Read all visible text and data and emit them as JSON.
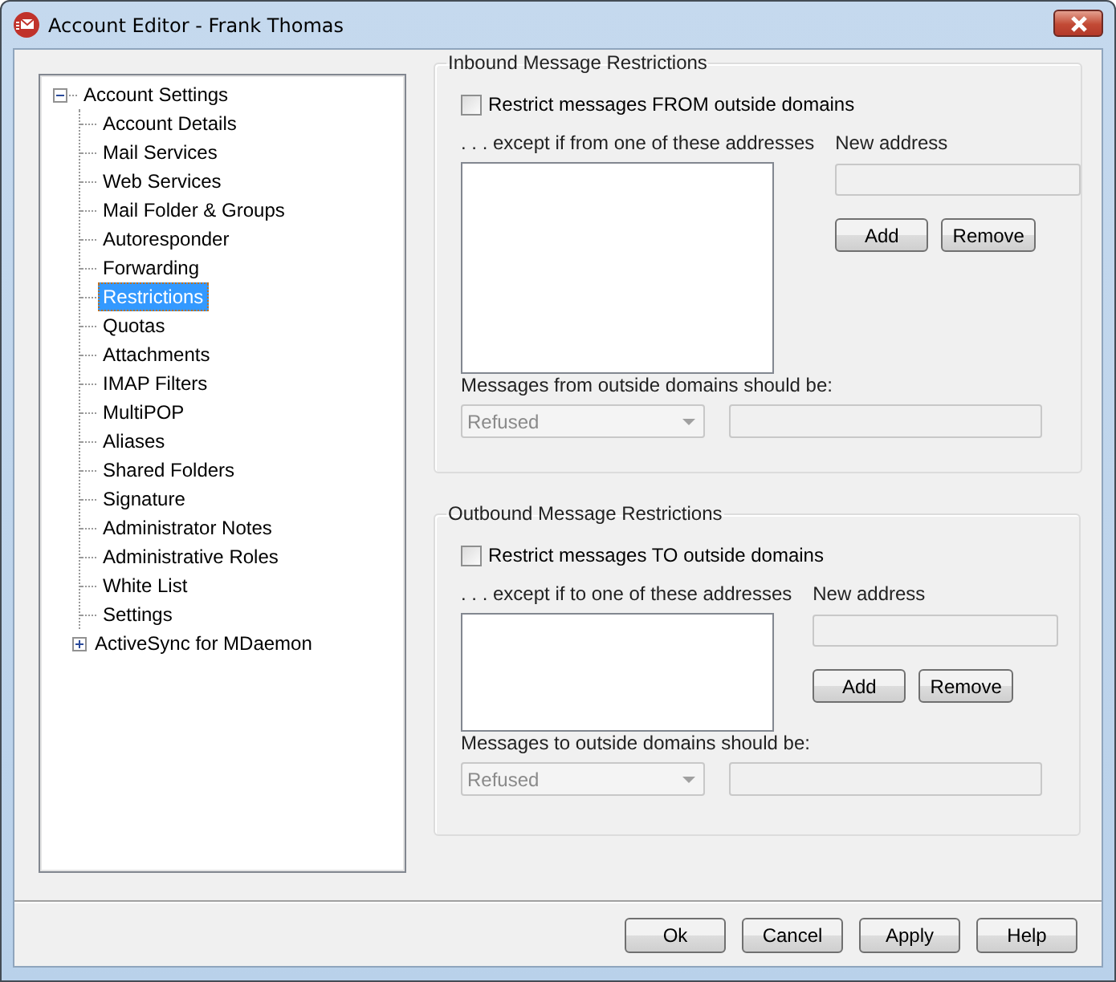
{
  "window": {
    "title": "Account Editor - Frank Thomas"
  },
  "tree": {
    "label": "Account Settings",
    "expanded": true,
    "selected": false,
    "children": [
      {
        "label": "Account Details",
        "selected": false
      },
      {
        "label": "Mail Services",
        "selected": false
      },
      {
        "label": "Web Services",
        "selected": false
      },
      {
        "label": "Mail Folder & Groups",
        "selected": false
      },
      {
        "label": "Autoresponder",
        "selected": false
      },
      {
        "label": "Forwarding",
        "selected": false
      },
      {
        "label": "Restrictions",
        "selected": true
      },
      {
        "label": "Quotas",
        "selected": false
      },
      {
        "label": "Attachments",
        "selected": false
      },
      {
        "label": "IMAP Filters",
        "selected": false
      },
      {
        "label": "MultiPOP",
        "selected": false
      },
      {
        "label": "Aliases",
        "selected": false
      },
      {
        "label": "Shared Folders",
        "selected": false
      },
      {
        "label": "Signature",
        "selected": false
      },
      {
        "label": "Administrator Notes",
        "selected": false
      },
      {
        "label": "Administrative Roles",
        "selected": false
      },
      {
        "label": "White List",
        "selected": false
      },
      {
        "label": "Settings",
        "selected": false
      },
      {
        "label": "ActiveSync for MDaemon",
        "selected": false,
        "expanded": false
      }
    ]
  },
  "sections": [
    {
      "title": "Inbound Message Restrictions",
      "checkbox": {
        "label": "Restrict messages FROM outside domains",
        "checked": false
      },
      "list_label": ". . . except if from one of these addresses",
      "new_address_label": "New address",
      "buttons": [
        "Add",
        "Remove"
      ],
      "action_label": "Messages from outside domains should be:",
      "action": {
        "value": "Refused",
        "disabled": true
      }
    },
    {
      "title": "Outbound Message Restrictions",
      "checkbox": {
        "label": "Restrict messages TO outside domains",
        "checked": false
      },
      "list_label": ". . . except if to one of these addresses",
      "new_address_label": "New address",
      "buttons": [
        "Add",
        "Remove"
      ],
      "action_label": "Messages to outside domains should be:",
      "action": {
        "value": "Refused",
        "disabled": true
      }
    }
  ],
  "footer_buttons": [
    "Ok",
    "Cancel",
    "Apply",
    "Help"
  ]
}
